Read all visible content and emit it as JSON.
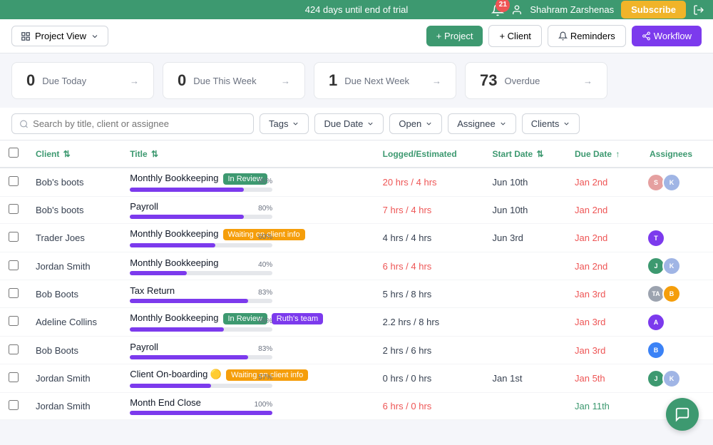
{
  "banner": {
    "trial_text": "424 days until end of trial",
    "notif_count": "21",
    "user_name": "Shahram Zarshenas",
    "subscribe_label": "Subscribe"
  },
  "toolbar": {
    "project_view_label": "Project View",
    "add_project_label": "+ Project",
    "add_client_label": "+ Client",
    "reminders_label": "Reminders",
    "workflow_label": "Workflow"
  },
  "stats": [
    {
      "count": "0",
      "label": "Due Today"
    },
    {
      "count": "0",
      "label": "Due This Week"
    },
    {
      "count": "1",
      "label": "Due Next Week"
    },
    {
      "count": "73",
      "label": "Overdue"
    }
  ],
  "filters": {
    "search_placeholder": "Search by title, client or assignee",
    "tags_label": "Tags",
    "due_date_label": "Due Date",
    "open_label": "Open",
    "assignee_label": "Assignee",
    "clients_label": "Clients"
  },
  "table": {
    "headers": [
      "",
      "Client",
      "Title",
      "Logged/Estimated",
      "Start Date",
      "Due Date",
      "Assignees"
    ],
    "rows": [
      {
        "client": "Bob's boots",
        "title": "Monthly Bookkeeping",
        "badges": [
          {
            "label": "In Review",
            "type": "green"
          }
        ],
        "progress": 80,
        "logged": "20 hrs",
        "estimated": "4 hrs",
        "logged_over": true,
        "start_date": "Jun 10th",
        "due_date": "Jan 2nd",
        "due_overdue": true,
        "avatars": [
          {
            "initials": "S",
            "color": "#e5a0a0"
          },
          {
            "initials": "K",
            "color": "#a0b5e5"
          }
        ]
      },
      {
        "client": "Bob's boots",
        "title": "Payroll",
        "badges": [],
        "progress": 80,
        "logged": "7 hrs",
        "estimated": "4 hrs",
        "logged_over": true,
        "start_date": "Jun 10th",
        "due_date": "Jan 2nd",
        "due_overdue": true,
        "avatars": []
      },
      {
        "client": "Trader Joes",
        "title": "Monthly Bookkeeping",
        "badges": [
          {
            "label": "Waiting on client info",
            "type": "orange"
          }
        ],
        "progress": 60,
        "logged": "4 hrs",
        "estimated": "4 hrs",
        "logged_over": false,
        "start_date": "Jun 3rd",
        "due_date": "Jan 2nd",
        "due_overdue": true,
        "avatars": [
          {
            "initials": "T",
            "color": "#7c3aed"
          }
        ]
      },
      {
        "client": "Jordan Smith",
        "title": "Monthly Bookkeeping",
        "badges": [],
        "progress": 40,
        "logged": "6 hrs",
        "estimated": "4 hrs",
        "logged_over": true,
        "start_date": "",
        "due_date": "Jan 2nd",
        "due_overdue": true,
        "avatars": [
          {
            "initials": "J",
            "color": "#3d9970"
          },
          {
            "initials": "K",
            "color": "#a0b5e5"
          }
        ]
      },
      {
        "client": "Bob Boots",
        "title": "Tax Return",
        "badges": [],
        "progress": 83,
        "logged": "5 hrs",
        "estimated": "8 hrs",
        "logged_over": false,
        "start_date": "",
        "due_date": "Jan 3rd",
        "due_overdue": true,
        "avatars": [
          {
            "initials": "TA",
            "color": "#9ca3af"
          },
          {
            "initials": "B",
            "color": "#f59e0b"
          }
        ]
      },
      {
        "client": "Adeline Collins",
        "title": "Monthly Bookkeeping",
        "badges": [
          {
            "label": "In Review",
            "type": "green"
          },
          {
            "label": "Ruth's team",
            "type": "purple"
          }
        ],
        "progress": 66,
        "logged": "2.2 hrs",
        "estimated": "8 hrs",
        "logged_over": false,
        "start_date": "",
        "due_date": "Jan 3rd",
        "due_overdue": true,
        "avatars": [
          {
            "initials": "A",
            "color": "#7c3aed"
          }
        ]
      },
      {
        "client": "Bob Boots",
        "title": "Payroll",
        "badges": [],
        "progress": 83,
        "logged": "2 hrs",
        "estimated": "6 hrs",
        "logged_over": false,
        "start_date": "",
        "due_date": "Jan 3rd",
        "due_overdue": true,
        "avatars": [
          {
            "initials": "B",
            "color": "#3b82f6"
          }
        ]
      },
      {
        "client": "Jordan Smith",
        "title": "Client On-boarding",
        "badges": [
          {
            "label": "Waiting on client info",
            "type": "orange"
          }
        ],
        "has_emoji": true,
        "progress": 57,
        "logged": "0 hrs",
        "estimated": "0 hrs",
        "logged_over": false,
        "start_date": "Jan 1st",
        "due_date": "Jan 5th",
        "due_overdue": true,
        "avatars": [
          {
            "initials": "J",
            "color": "#3d9970"
          },
          {
            "initials": "K",
            "color": "#a0b5e5"
          }
        ]
      },
      {
        "client": "Jordan Smith",
        "title": "Month End Close",
        "badges": [],
        "progress": 100,
        "logged": "6 hrs",
        "estimated": "0 hrs",
        "logged_over": true,
        "start_date": "",
        "due_date": "Jan 11th",
        "due_overdue": false,
        "avatars": []
      }
    ]
  }
}
